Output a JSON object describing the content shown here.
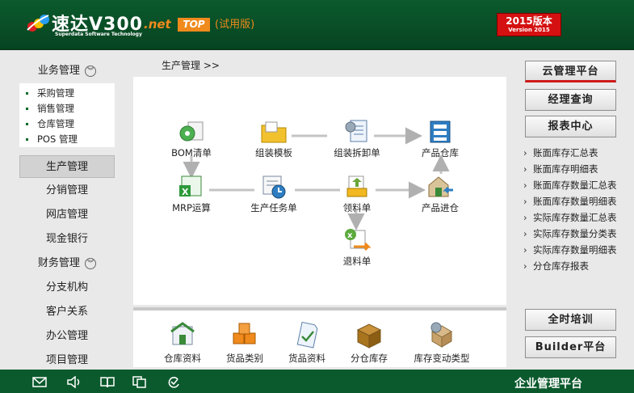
{
  "header": {
    "logo_name": "速达V300",
    "logo_net": ".net",
    "logo_sub": "Superdata Software Technology",
    "top_badge": "TOP",
    "trial": "(试用版)",
    "version_line1": "2015版本",
    "version_line2": "Version 2015"
  },
  "sidebar": {
    "group1": "业务管理",
    "sub_items": [
      "采购管理",
      "销售管理",
      "仓库管理",
      "POS 管理"
    ],
    "items": [
      "生产管理",
      "分销管理",
      "网店管理",
      "现金银行"
    ],
    "group2": "财务管理",
    "items2": [
      "分支机构",
      "客户关系",
      "办公管理",
      "项目管理"
    ]
  },
  "main": {
    "breadcrumb": "生产管理  >>",
    "nodes": {
      "bom": "BOM清单",
      "template": "组装模板",
      "assembly": "组装拆卸单",
      "warehouse": "产品仓库",
      "mrp": "MRP运算",
      "task": "生产任务单",
      "pick": "领料单",
      "inbound": "产品进仓",
      "return": "退料单"
    },
    "bottom": [
      "仓库资料",
      "货品类别",
      "货品资料",
      "分仓库存",
      "库存变动类型"
    ]
  },
  "right": {
    "cloud": "云管理平台",
    "manager": "经理查询",
    "reports_center": "报表中心",
    "reports": [
      "账面库存汇总表",
      "账面库存明细表",
      "账面库存数量汇总表",
      "账面库存数量明细表",
      "实际库存数量汇总表",
      "实际库存数量分类表",
      "实际库存数量明细表",
      "分仓库存报表"
    ],
    "training": "全时培训",
    "builder": "Builder平台"
  },
  "footer": {
    "title": "企业管理平台"
  },
  "colors": {
    "header_green": "#0b5a2d",
    "accent_orange": "#f08a1c",
    "version_red": "#d41010"
  }
}
